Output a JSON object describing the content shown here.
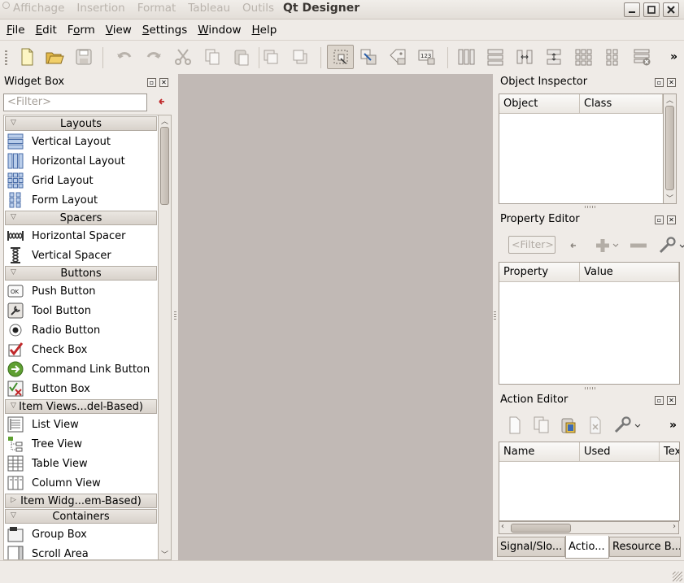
{
  "window": {
    "title": "Qt Designer",
    "ghost_menu": [
      "Affichage",
      "Insertion",
      "Format",
      "Tableau",
      "Outils"
    ]
  },
  "menubar": [
    {
      "label": "File",
      "u": "F",
      "rest": "ile"
    },
    {
      "label": "Edit",
      "u": "E",
      "rest": "dit"
    },
    {
      "label": "Form",
      "pre": "F",
      "u": "o",
      "rest": "rm"
    },
    {
      "label": "View",
      "u": "V",
      "rest": "iew"
    },
    {
      "label": "Settings",
      "u": "S",
      "rest": "ettings"
    },
    {
      "label": "Window",
      "u": "W",
      "rest": "indow"
    },
    {
      "label": "Help",
      "u": "H",
      "rest": "elp"
    }
  ],
  "toolbar": {
    "more": "»",
    "icons": [
      "new-form-icon",
      "open-icon",
      "save-icon",
      "undo-icon",
      "redo-icon",
      "cut-icon",
      "copy-icon",
      "paste-icon",
      "lower-icon",
      "raise-icon",
      "edit-widgets-icon",
      "edit-signals-slots-icon",
      "edit-buddies-icon",
      "edit-tab-order-icon",
      "lay-out-horizontally-icon",
      "lay-out-vertically-icon",
      "lay-out-horizontal-splitter-icon",
      "lay-out-vertical-splitter-icon",
      "lay-out-grid-icon",
      "lay-out-form-icon",
      "break-layout-icon"
    ]
  },
  "widget_box": {
    "title": "Widget Box",
    "filter_placeholder": "<Filter>",
    "categories": [
      {
        "name": "Layouts",
        "expanded": true,
        "items": [
          {
            "label": "Vertical Layout",
            "icon": "vertical-layout-icon"
          },
          {
            "label": "Horizontal Layout",
            "icon": "horizontal-layout-icon"
          },
          {
            "label": "Grid Layout",
            "icon": "grid-layout-icon"
          },
          {
            "label": "Form Layout",
            "icon": "form-layout-icon"
          }
        ]
      },
      {
        "name": "Spacers",
        "expanded": true,
        "items": [
          {
            "label": "Horizontal Spacer",
            "icon": "horizontal-spacer-icon"
          },
          {
            "label": "Vertical Spacer",
            "icon": "vertical-spacer-icon"
          }
        ]
      },
      {
        "name": "Buttons",
        "expanded": true,
        "items": [
          {
            "label": "Push Button",
            "icon": "push-button-icon"
          },
          {
            "label": "Tool Button",
            "icon": "tool-button-icon"
          },
          {
            "label": "Radio Button",
            "icon": "radio-button-icon"
          },
          {
            "label": "Check Box",
            "icon": "check-box-icon"
          },
          {
            "label": "Command Link Button",
            "icon": "command-link-icon"
          },
          {
            "label": "Button Box",
            "icon": "button-box-icon"
          }
        ]
      },
      {
        "name": "Item Views...del-Based)",
        "expanded": true,
        "items": [
          {
            "label": "List View",
            "icon": "list-view-icon"
          },
          {
            "label": "Tree View",
            "icon": "tree-view-icon"
          },
          {
            "label": "Table View",
            "icon": "table-view-icon"
          },
          {
            "label": "Column View",
            "icon": "column-view-icon"
          }
        ]
      },
      {
        "name": "Item Widg...em-Based)",
        "expanded": false,
        "items": []
      },
      {
        "name": "Containers",
        "expanded": true,
        "items": [
          {
            "label": "Group Box",
            "icon": "group-box-icon"
          },
          {
            "label": "Scroll Area",
            "icon": "scroll-area-icon"
          }
        ]
      }
    ]
  },
  "object_inspector": {
    "title": "Object Inspector",
    "columns": [
      "Object",
      "Class"
    ]
  },
  "property_editor": {
    "title": "Property Editor",
    "filter_placeholder": "<Filter>",
    "columns": [
      "Property",
      "Value"
    ]
  },
  "action_editor": {
    "title": "Action Editor",
    "columns": [
      "Name",
      "Used",
      "Tex"
    ],
    "more": "»"
  },
  "bottom_tabs": [
    {
      "label": "Signal/Slo...",
      "selected": false
    },
    {
      "label": "Actio...",
      "selected": true
    },
    {
      "label": "Resource B...",
      "selected": false
    }
  ],
  "colors": {
    "window_bg": "#efebe7",
    "central_bg": "#c1b9b5",
    "accent_red": "#c0282a"
  }
}
